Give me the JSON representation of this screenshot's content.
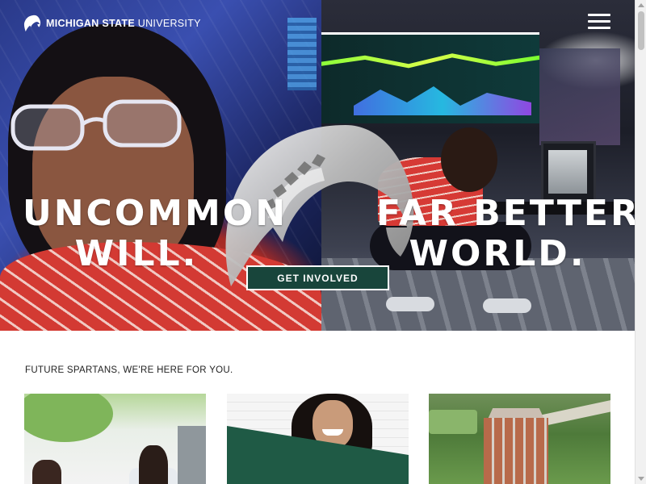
{
  "header": {
    "logo_bold": "MICHIGAN STATE",
    "logo_light": "UNIVERSITY",
    "logo_icon": "spartan-helmet-icon",
    "menu_icon": "hamburger-menu-icon"
  },
  "hero": {
    "headline_left": [
      "UNCOMMON",
      "WILL."
    ],
    "headline_right": [
      "FAR BETTER",
      "WORLD."
    ],
    "cta_label": "GET INVOLVED",
    "center_icon": "spartan-helmet-icon"
  },
  "section": {
    "title": "FUTURE SPARTANS, WE'RE HERE FOR YOU."
  },
  "colors": {
    "brand_green": "#18453b",
    "white": "#ffffff"
  }
}
